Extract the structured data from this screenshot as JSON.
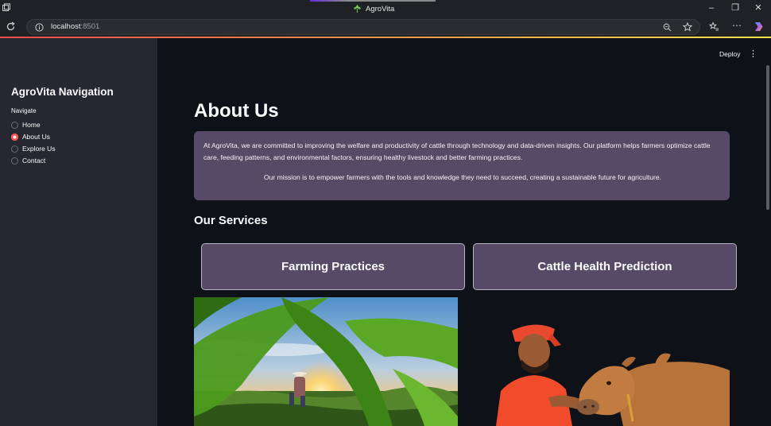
{
  "browser": {
    "tab_title": "AgroVita",
    "url_host": "localhost",
    "url_port": ":8501"
  },
  "header": {
    "deploy_label": "Deploy"
  },
  "sidebar": {
    "title": "AgroVita Navigation",
    "radio_label": "Navigate",
    "items": [
      {
        "label": "Home",
        "selected": false
      },
      {
        "label": "About Us",
        "selected": true
      },
      {
        "label": "Explore Us",
        "selected": false
      },
      {
        "label": "Contact",
        "selected": false
      }
    ]
  },
  "main": {
    "title": "About Us",
    "about_paragraph_1": "At AgroVita, we are committed to improving the welfare and productivity of cattle through technology and data-driven insights. Our platform helps farmers optimize cattle care, feeding patterns, and environmental factors, ensuring healthy livestock and better farming practices.",
    "about_paragraph_2": "Our mission is to empower farmers with the tools and knowledge they need to succeed, creating a sustainable future for agriculture.",
    "services_title": "Our Services",
    "services": [
      {
        "label": "Farming Practices"
      },
      {
        "label": "Cattle Health Prediction"
      }
    ]
  },
  "colors": {
    "accent": "#ff4b4b",
    "card_bg": "#574a66",
    "sidebar_bg": "#262730",
    "main_bg": "#0e1117"
  }
}
